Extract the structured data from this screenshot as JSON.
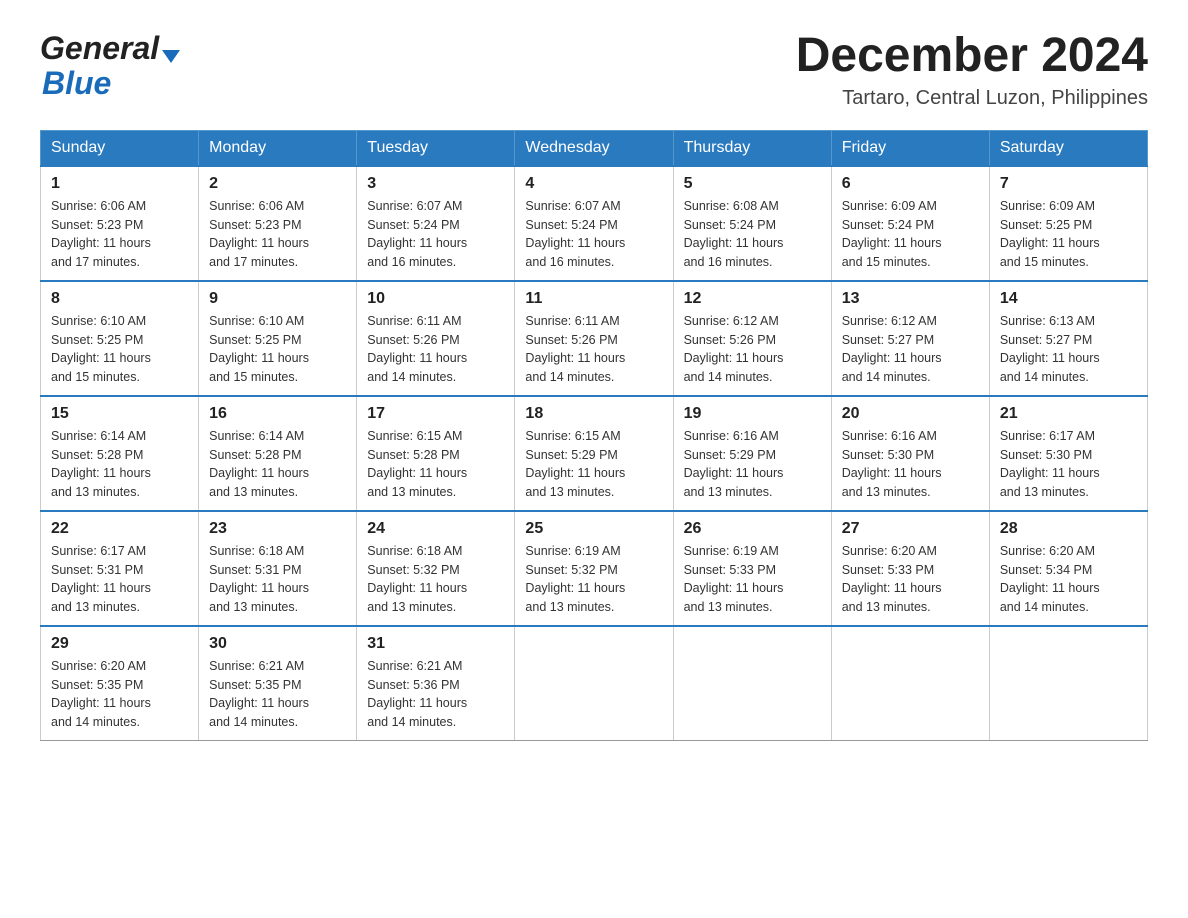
{
  "header": {
    "logo_general": "General",
    "logo_blue": "Blue",
    "month_year": "December 2024",
    "location": "Tartaro, Central Luzon, Philippines"
  },
  "days_of_week": [
    "Sunday",
    "Monday",
    "Tuesday",
    "Wednesday",
    "Thursday",
    "Friday",
    "Saturday"
  ],
  "weeks": [
    [
      {
        "day": "1",
        "sunrise": "6:06 AM",
        "sunset": "5:23 PM",
        "daylight": "11 hours and 17 minutes."
      },
      {
        "day": "2",
        "sunrise": "6:06 AM",
        "sunset": "5:23 PM",
        "daylight": "11 hours and 17 minutes."
      },
      {
        "day": "3",
        "sunrise": "6:07 AM",
        "sunset": "5:24 PM",
        "daylight": "11 hours and 16 minutes."
      },
      {
        "day": "4",
        "sunrise": "6:07 AM",
        "sunset": "5:24 PM",
        "daylight": "11 hours and 16 minutes."
      },
      {
        "day": "5",
        "sunrise": "6:08 AM",
        "sunset": "5:24 PM",
        "daylight": "11 hours and 16 minutes."
      },
      {
        "day": "6",
        "sunrise": "6:09 AM",
        "sunset": "5:24 PM",
        "daylight": "11 hours and 15 minutes."
      },
      {
        "day": "7",
        "sunrise": "6:09 AM",
        "sunset": "5:25 PM",
        "daylight": "11 hours and 15 minutes."
      }
    ],
    [
      {
        "day": "8",
        "sunrise": "6:10 AM",
        "sunset": "5:25 PM",
        "daylight": "11 hours and 15 minutes."
      },
      {
        "day": "9",
        "sunrise": "6:10 AM",
        "sunset": "5:25 PM",
        "daylight": "11 hours and 15 minutes."
      },
      {
        "day": "10",
        "sunrise": "6:11 AM",
        "sunset": "5:26 PM",
        "daylight": "11 hours and 14 minutes."
      },
      {
        "day": "11",
        "sunrise": "6:11 AM",
        "sunset": "5:26 PM",
        "daylight": "11 hours and 14 minutes."
      },
      {
        "day": "12",
        "sunrise": "6:12 AM",
        "sunset": "5:26 PM",
        "daylight": "11 hours and 14 minutes."
      },
      {
        "day": "13",
        "sunrise": "6:12 AM",
        "sunset": "5:27 PM",
        "daylight": "11 hours and 14 minutes."
      },
      {
        "day": "14",
        "sunrise": "6:13 AM",
        "sunset": "5:27 PM",
        "daylight": "11 hours and 14 minutes."
      }
    ],
    [
      {
        "day": "15",
        "sunrise": "6:14 AM",
        "sunset": "5:28 PM",
        "daylight": "11 hours and 13 minutes."
      },
      {
        "day": "16",
        "sunrise": "6:14 AM",
        "sunset": "5:28 PM",
        "daylight": "11 hours and 13 minutes."
      },
      {
        "day": "17",
        "sunrise": "6:15 AM",
        "sunset": "5:28 PM",
        "daylight": "11 hours and 13 minutes."
      },
      {
        "day": "18",
        "sunrise": "6:15 AM",
        "sunset": "5:29 PM",
        "daylight": "11 hours and 13 minutes."
      },
      {
        "day": "19",
        "sunrise": "6:16 AM",
        "sunset": "5:29 PM",
        "daylight": "11 hours and 13 minutes."
      },
      {
        "day": "20",
        "sunrise": "6:16 AM",
        "sunset": "5:30 PM",
        "daylight": "11 hours and 13 minutes."
      },
      {
        "day": "21",
        "sunrise": "6:17 AM",
        "sunset": "5:30 PM",
        "daylight": "11 hours and 13 minutes."
      }
    ],
    [
      {
        "day": "22",
        "sunrise": "6:17 AM",
        "sunset": "5:31 PM",
        "daylight": "11 hours and 13 minutes."
      },
      {
        "day": "23",
        "sunrise": "6:18 AM",
        "sunset": "5:31 PM",
        "daylight": "11 hours and 13 minutes."
      },
      {
        "day": "24",
        "sunrise": "6:18 AM",
        "sunset": "5:32 PM",
        "daylight": "11 hours and 13 minutes."
      },
      {
        "day": "25",
        "sunrise": "6:19 AM",
        "sunset": "5:32 PM",
        "daylight": "11 hours and 13 minutes."
      },
      {
        "day": "26",
        "sunrise": "6:19 AM",
        "sunset": "5:33 PM",
        "daylight": "11 hours and 13 minutes."
      },
      {
        "day": "27",
        "sunrise": "6:20 AM",
        "sunset": "5:33 PM",
        "daylight": "11 hours and 13 minutes."
      },
      {
        "day": "28",
        "sunrise": "6:20 AM",
        "sunset": "5:34 PM",
        "daylight": "11 hours and 14 minutes."
      }
    ],
    [
      {
        "day": "29",
        "sunrise": "6:20 AM",
        "sunset": "5:35 PM",
        "daylight": "11 hours and 14 minutes."
      },
      {
        "day": "30",
        "sunrise": "6:21 AM",
        "sunset": "5:35 PM",
        "daylight": "11 hours and 14 minutes."
      },
      {
        "day": "31",
        "sunrise": "6:21 AM",
        "sunset": "5:36 PM",
        "daylight": "11 hours and 14 minutes."
      },
      {
        "day": "",
        "sunrise": "",
        "sunset": "",
        "daylight": ""
      },
      {
        "day": "",
        "sunrise": "",
        "sunset": "",
        "daylight": ""
      },
      {
        "day": "",
        "sunrise": "",
        "sunset": "",
        "daylight": ""
      },
      {
        "day": "",
        "sunrise": "",
        "sunset": "",
        "daylight": ""
      }
    ]
  ],
  "labels": {
    "sunrise": "Sunrise:",
    "sunset": "Sunset:",
    "daylight": "Daylight:"
  }
}
